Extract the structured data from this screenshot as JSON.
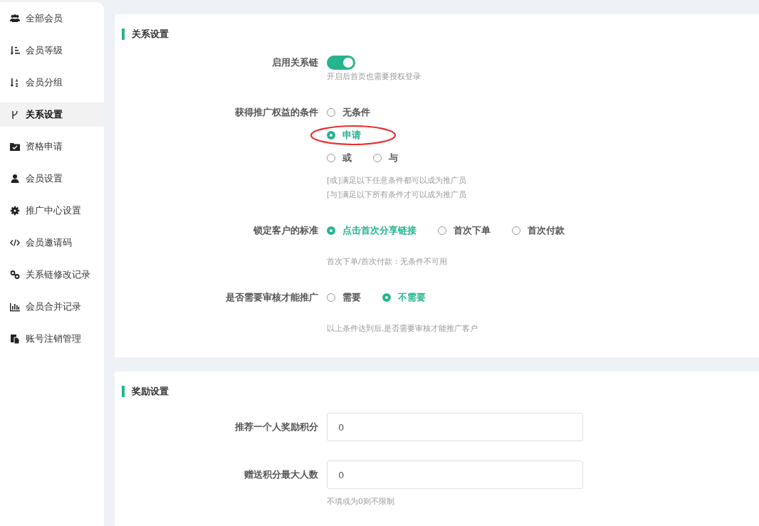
{
  "sidebar": {
    "items": [
      {
        "label": "全部会员",
        "selected": false
      },
      {
        "label": "会员等级",
        "selected": false
      },
      {
        "label": "会员分组",
        "selected": false
      },
      {
        "label": "关系设置",
        "selected": true
      },
      {
        "label": "资格申请",
        "selected": false
      },
      {
        "label": "会员设置",
        "selected": false
      },
      {
        "label": "推广中心设置",
        "selected": false
      },
      {
        "label": "会员邀请码",
        "selected": false
      },
      {
        "label": "关系链修改记录",
        "selected": false
      },
      {
        "label": "会员合并记录",
        "selected": false
      },
      {
        "label": "账号注销管理",
        "selected": false
      }
    ]
  },
  "sections": [
    {
      "title": "关系设置",
      "fields": [
        {
          "kind": "switch",
          "label": "启用关系链",
          "on": true,
          "hints": [
            "开启后首页也需要授权登录"
          ]
        },
        {
          "kind": "radio",
          "label": "获得推广权益的条件",
          "option_rows": [
            [
              {
                "label": "无条件",
                "selected": false,
                "annotated": false
              }
            ],
            [
              {
                "label": "申请",
                "selected": true,
                "annotated": true
              }
            ],
            [
              {
                "label": "或",
                "selected": false,
                "annotated": false
              },
              {
                "label": "与",
                "selected": false,
                "annotated": false
              }
            ]
          ],
          "hints": [
            "[或]满足以下任意条件都可以成为推广员",
            "[与]满足以下所有条件才可以成为推广员"
          ]
        },
        {
          "kind": "radio",
          "label": "锁定客户的标准",
          "option_rows": [
            [
              {
                "label": "点击首次分享链接",
                "selected": true,
                "annotated": false
              },
              {
                "label": "首次下单",
                "selected": false,
                "annotated": false
              },
              {
                "label": "首次付款",
                "selected": false,
                "annotated": false
              }
            ]
          ],
          "hints": [
            "首次下单/首次付款：无条件不可用"
          ]
        },
        {
          "kind": "radio",
          "label": "是否需要审核才能推广",
          "option_rows": [
            [
              {
                "label": "需要",
                "selected": false,
                "annotated": false
              },
              {
                "label": "不需要",
                "selected": true,
                "annotated": false
              }
            ]
          ],
          "hints": [
            "以上条件达到后,是否需要审核才能推广客户"
          ]
        }
      ]
    },
    {
      "title": "奖励设置",
      "fields": [
        {
          "kind": "input",
          "label": "推荐一个人奖励积分",
          "value": "0"
        },
        {
          "kind": "input",
          "label": "赠送积分最大人数",
          "value": "0",
          "hints": [
            "不填或为0则不限制"
          ]
        }
      ]
    }
  ]
}
